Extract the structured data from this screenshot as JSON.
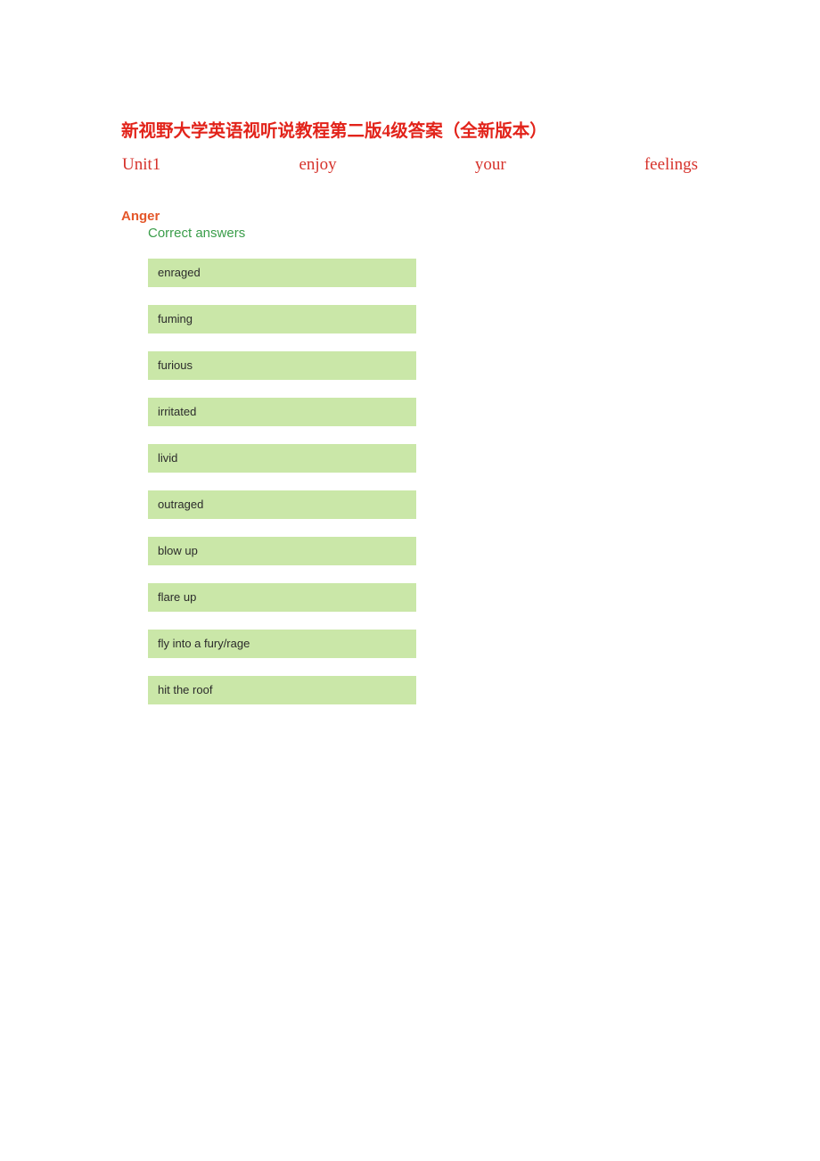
{
  "document": {
    "title": "新视野大学英语视听说教程第二版4级答案（全新版本）",
    "unit_line": {
      "unit": "Unit1",
      "word2": "enjoy",
      "word3": "your",
      "word4": "feelings"
    },
    "section": {
      "heading": "Anger",
      "answers_label": "Correct answers",
      "answers": [
        "enraged",
        "fuming",
        "furious",
        "irritated",
        "livid",
        "outraged",
        "blow up",
        "flare up",
        "fly into a fury/rage",
        "hit the roof"
      ]
    }
  },
  "colors": {
    "title_red": "#e2231a",
    "unit_red": "#d6322b",
    "heading_orange": "#e4572a",
    "label_green": "#3a9d4a",
    "chip_background": "#cae7a8",
    "chip_text": "#2b2b2b",
    "page_background": "#ffffff"
  }
}
